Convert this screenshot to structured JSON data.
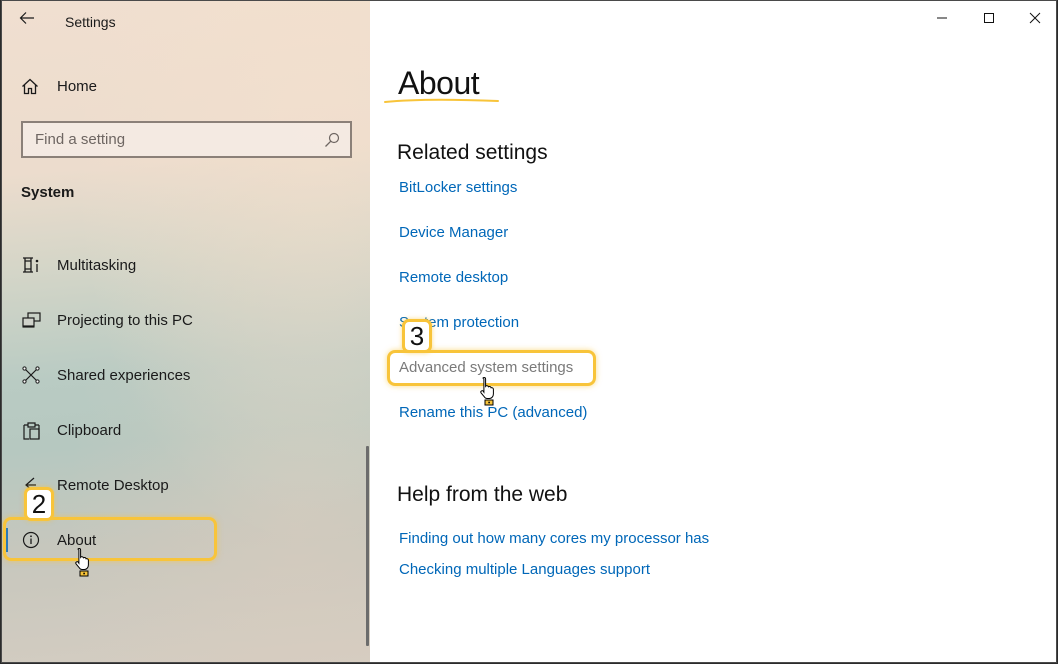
{
  "window": {
    "app_title": "Settings",
    "controls": {
      "minimize": "minimize-icon",
      "maximize": "maximize-icon",
      "close": "close-icon"
    }
  },
  "sidebar": {
    "back_icon": "arrow-left-icon",
    "home": {
      "label": "Home",
      "icon": "home-icon"
    },
    "search": {
      "placeholder": "Find a setting",
      "value": "",
      "icon": "search-icon"
    },
    "section_title": "System",
    "items": [
      {
        "label": "Multitasking",
        "icon": "multitasking-icon",
        "selected": false
      },
      {
        "label": "Projecting to this PC",
        "icon": "projecting-icon",
        "selected": false
      },
      {
        "label": "Shared experiences",
        "icon": "shared-experiences-icon",
        "selected": false
      },
      {
        "label": "Clipboard",
        "icon": "clipboard-icon",
        "selected": false
      },
      {
        "label": "Remote Desktop",
        "icon": "remote-desktop-icon",
        "selected": false
      },
      {
        "label": "About",
        "icon": "info-icon",
        "selected": true
      }
    ]
  },
  "main": {
    "page_title": "About",
    "related_settings": {
      "heading": "Related settings",
      "links": [
        "BitLocker settings",
        "Device Manager",
        "Remote desktop",
        "System protection",
        "Advanced system settings",
        "Rename this PC (advanced)"
      ]
    },
    "help": {
      "heading": "Help from the web",
      "links": [
        "Finding out how many cores my processor has",
        "Checking multiple Languages support"
      ]
    }
  },
  "annotations": {
    "step_2": "2",
    "step_3": "3",
    "highlight_color": "#f8c43a"
  },
  "colors": {
    "link": "#0067b8",
    "link_hover": "#7a7a7a",
    "selected_indicator": "#2a7ab8"
  }
}
